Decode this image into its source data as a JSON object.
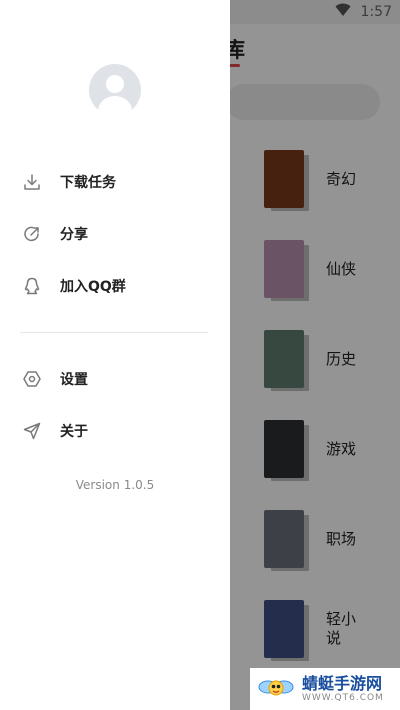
{
  "status_bar": {
    "time": "1:57",
    "wifi_icon": "wifi-icon"
  },
  "background_screen": {
    "title": "库",
    "categories": [
      {
        "label": "奇幻",
        "cover_color": "#7a3a1c"
      },
      {
        "label": "仙侠",
        "cover_color": "#b68fae"
      },
      {
        "label": "历史",
        "cover_color": "#5f7c70"
      },
      {
        "label": "游戏",
        "cover_color": "#2e2f33"
      },
      {
        "label": "职场",
        "cover_color": "#6c6f7a"
      },
      {
        "label": "轻小说",
        "cover_color": "#3f4e83"
      }
    ]
  },
  "drawer": {
    "avatar": "default-avatar",
    "menu_primary": [
      {
        "label": "下载任务",
        "icon": "download-icon"
      },
      {
        "label": "分享",
        "icon": "share-icon"
      },
      {
        "label": "加入QQ群",
        "icon": "qq-icon"
      }
    ],
    "menu_secondary": [
      {
        "label": "设置",
        "icon": "settings-icon"
      },
      {
        "label": "关于",
        "icon": "send-icon"
      }
    ],
    "version": "Version 1.0.5"
  },
  "watermark": {
    "main": "蜻蜓手游网",
    "sub": "WWW.QT6.COM"
  }
}
